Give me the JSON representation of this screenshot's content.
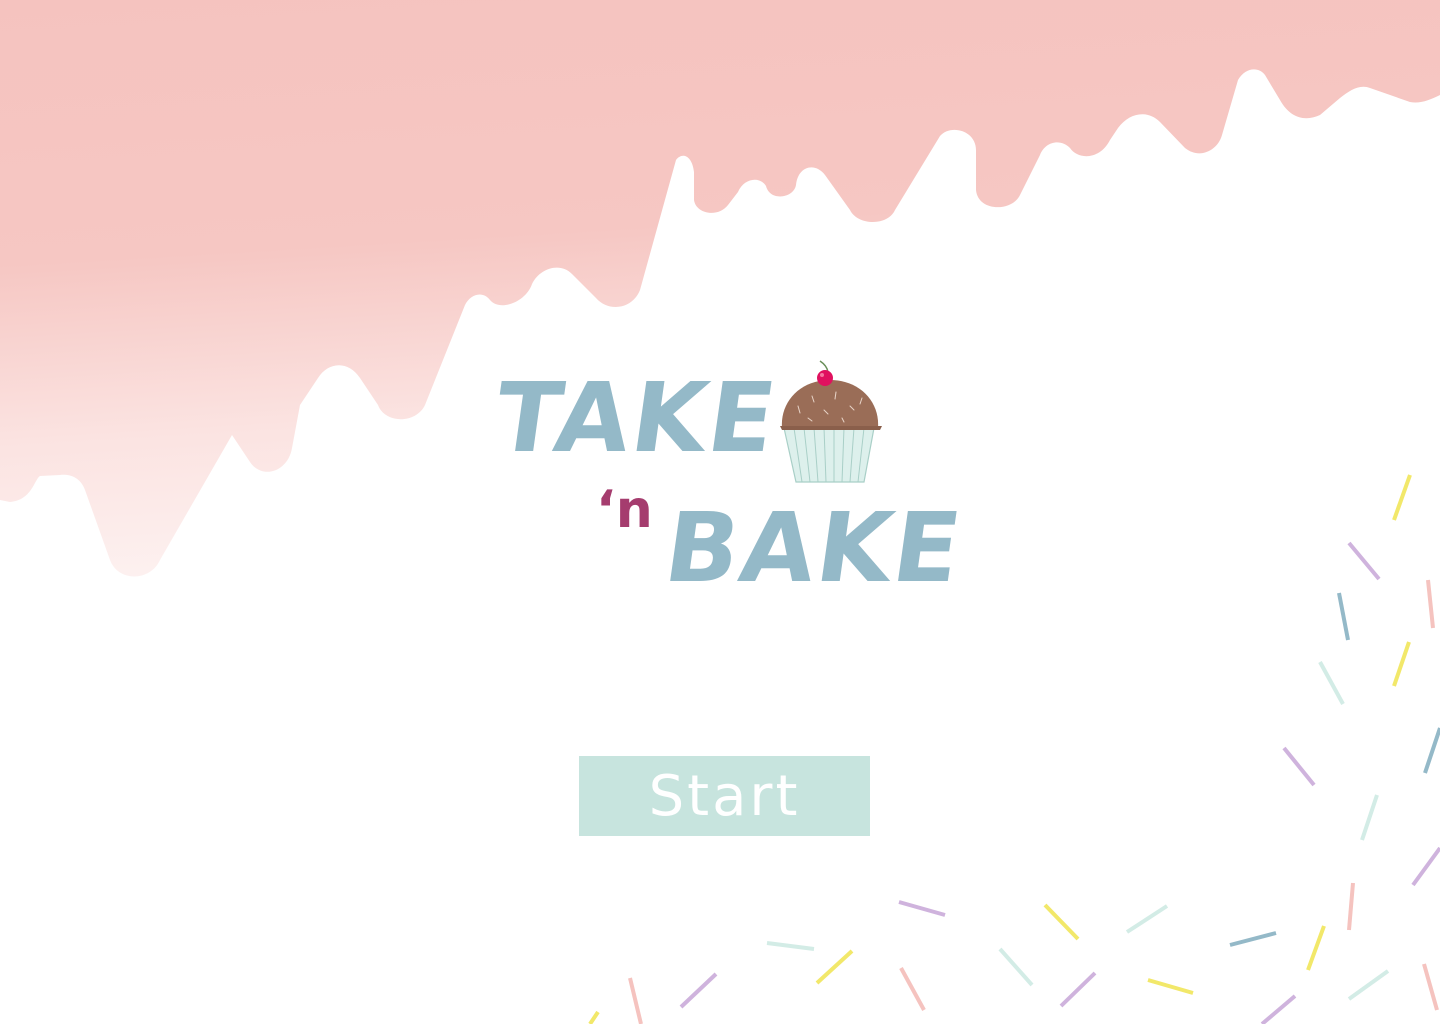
{
  "title": {
    "line1": "TAKE",
    "connector": "‘n",
    "line2": "BAKE"
  },
  "start_button": {
    "label": "Start"
  },
  "icons": {
    "logo_icon": "cupcake-icon"
  },
  "colors": {
    "background": "#ffffff",
    "drip": "#f5c3bf",
    "logo_text": "#94b9c8",
    "logo_accent": "#a53c6e",
    "button_bg": "#c7e4de",
    "button_text": "#ffffff",
    "sprinkle_yellow": "#f2e86a",
    "sprinkle_purple": "#cfb3dd",
    "sprinkle_pink": "#f5c3bf",
    "sprinkle_mint": "#d3ece6",
    "sprinkle_blue": "#94b9c8"
  }
}
